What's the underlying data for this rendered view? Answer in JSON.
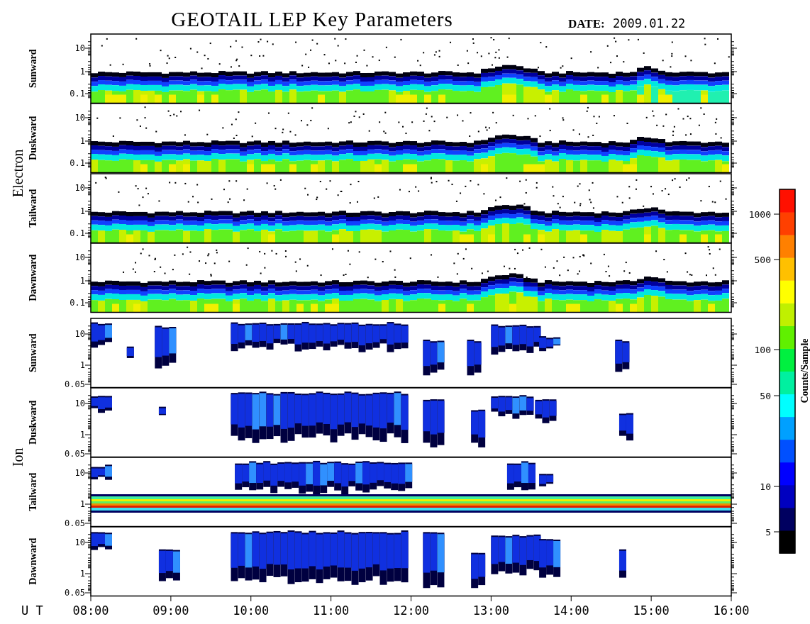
{
  "title": "GEOTAIL LEP Key Parameters",
  "date": {
    "label": "DATE:",
    "value": "2009.01.22"
  },
  "groups": [
    {
      "label": "Electron",
      "panels": [
        {
          "label": "Sunward",
          "kind": "electron",
          "yticks": [
            "10",
            "1",
            "0.1"
          ]
        },
        {
          "label": "Duskward",
          "kind": "electron",
          "yticks": [
            "10",
            "1",
            "0.1"
          ]
        },
        {
          "label": "Tailward",
          "kind": "electron",
          "yticks": [
            "10",
            "1",
            "0.1"
          ]
        },
        {
          "label": "Dawnward",
          "kind": "electron",
          "yticks": [
            "10",
            "1",
            "0.1"
          ]
        }
      ]
    },
    {
      "label": "Ion",
      "panels": [
        {
          "label": "Sunward",
          "kind": "ion",
          "yticks": [
            "10",
            "1",
            "0.05"
          ]
        },
        {
          "label": "Duskward",
          "kind": "ion",
          "yticks": [
            "10",
            "1",
            "0.05"
          ]
        },
        {
          "label": "Tailward",
          "kind": "ion-band",
          "yticks": [
            "10",
            "1",
            "0.05"
          ]
        },
        {
          "label": "Dawnward",
          "kind": "ion",
          "yticks": [
            "10",
            "1",
            "0.05"
          ]
        }
      ]
    }
  ],
  "x_axis": {
    "label": "U T",
    "ticks": [
      "08:00",
      "09:00",
      "10:00",
      "11:00",
      "12:00",
      "13:00",
      "14:00",
      "15:00",
      "16:00"
    ]
  },
  "colorbar": {
    "label": "Counts/Sample",
    "ticks": [
      "1000",
      "500",
      "100",
      "50",
      "10",
      "5"
    ]
  }
}
